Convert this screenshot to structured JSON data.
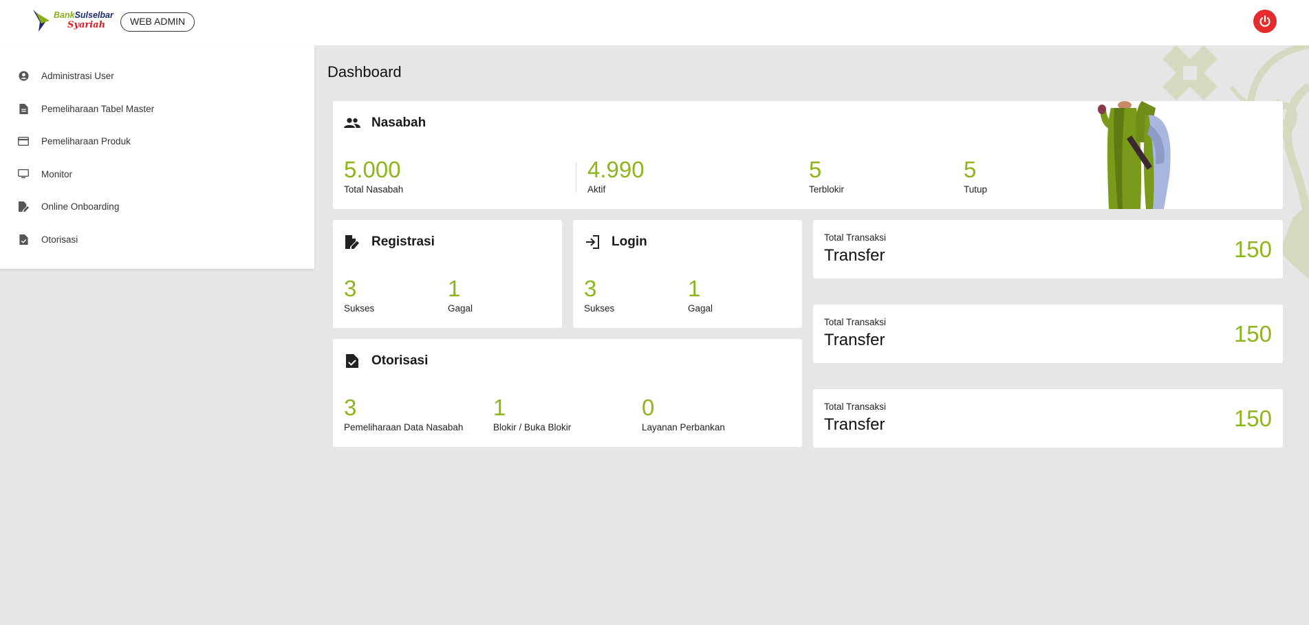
{
  "header": {
    "brand_line1_a": "Bank",
    "brand_line1_b": "Sulselbar",
    "brand_line2": "Syariah",
    "badge": "WEB ADMIN",
    "power_icon": "power-icon"
  },
  "sidebar": {
    "items": [
      {
        "label": "Administrasi User",
        "icon": "user-circle-icon"
      },
      {
        "label": "Pemeliharaan Tabel Master",
        "icon": "document-icon"
      },
      {
        "label": "Pemeliharaan Produk",
        "icon": "credit-card-icon"
      },
      {
        "label": "Monitor",
        "icon": "monitor-icon"
      },
      {
        "label": "Online Onboarding",
        "icon": "edit-document-icon"
      },
      {
        "label": "Otorisasi",
        "icon": "approve-document-icon"
      }
    ]
  },
  "main": {
    "title": "Dashboard",
    "nasabah": {
      "title": "Nasabah",
      "stats": [
        {
          "value": "5.000",
          "label": "Total Nasabah"
        },
        {
          "value": "4.990",
          "label": "Aktif"
        },
        {
          "value": "5",
          "label": "Terblokir"
        },
        {
          "value": "5",
          "label": "Tutup"
        }
      ]
    },
    "registrasi": {
      "title": "Registrasi",
      "stats": [
        {
          "value": "3",
          "label": "Sukses"
        },
        {
          "value": "1",
          "label": "Gagal"
        }
      ]
    },
    "login": {
      "title": "Login",
      "stats": [
        {
          "value": "3",
          "label": "Sukses"
        },
        {
          "value": "1",
          "label": "Gagal"
        }
      ]
    },
    "otorisasi": {
      "title": "Otorisasi",
      "stats": [
        {
          "value": "3",
          "label": "Pemeliharaan Data Nasabah"
        },
        {
          "value": "1",
          "label": "Blokir / Buka Blokir"
        },
        {
          "value": "0",
          "label": "Layanan Perbankan"
        }
      ]
    },
    "transactions": [
      {
        "subtitle": "Total Transaksi",
        "title": "Transfer",
        "value": "150"
      },
      {
        "subtitle": "Total Transaksi",
        "title": "Transfer",
        "value": "150"
      },
      {
        "subtitle": "Total Transaksi",
        "title": "Transfer",
        "value": "150"
      }
    ]
  },
  "colors": {
    "accent_green": "#8db51c",
    "power_red": "#e52b2b",
    "background": "#e6e6e6"
  }
}
